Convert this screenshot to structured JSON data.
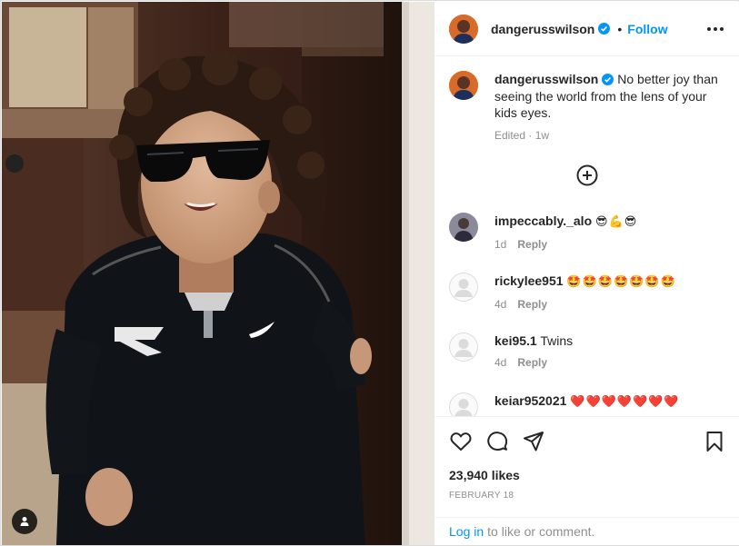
{
  "post": {
    "username": "dangerusswilson",
    "follow_label": "Follow",
    "separator": "•",
    "caption": "No better joy than seeing the world from the lens of your kids eyes.",
    "edited_label": "Edited",
    "time_ago": "1w",
    "likes": "23,940 likes",
    "date": "FEBRUARY 18"
  },
  "comments": [
    {
      "username": "impeccably._alo",
      "text": "😎💪😎",
      "time": "1d",
      "reply": "Reply"
    },
    {
      "username": "rickylee951",
      "text": "🤩🤩🤩🤩🤩🤩🤩",
      "time": "4d",
      "reply": "Reply"
    },
    {
      "username": "kei95.1",
      "text": "Twins",
      "time": "4d",
      "reply": "Reply"
    },
    {
      "username": "keiar952021",
      "text": "❤️❤️❤️❤️❤️❤️❤️",
      "time": "",
      "reply": ""
    }
  ],
  "footer": {
    "login_link": "Log in",
    "login_rest": "to like or comment."
  },
  "icons": [
    "verified-badge-icon",
    "more-options-icon",
    "load-more-comments-icon",
    "heart-icon",
    "comment-icon",
    "share-icon",
    "bookmark-icon",
    "user-tag-icon"
  ],
  "colors": {
    "accent": "#0095f6",
    "text": "#262626",
    "muted": "#8e8e8e",
    "border": "#efefef"
  }
}
